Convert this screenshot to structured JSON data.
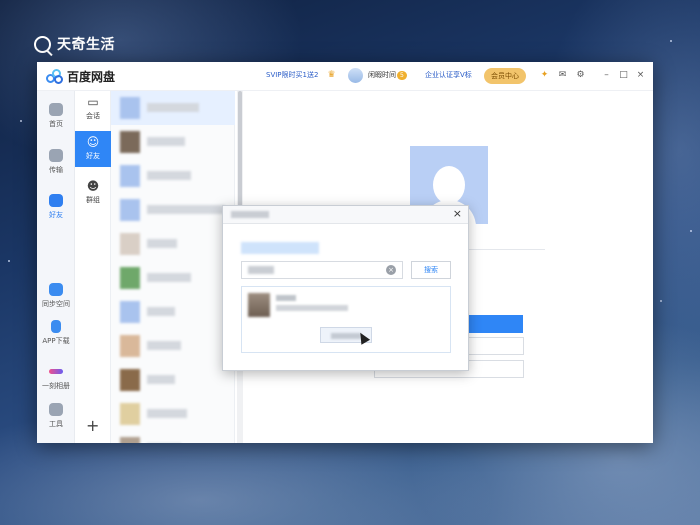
{
  "watermark": {
    "text": "天奇生活"
  },
  "app": {
    "name": "百度网盘",
    "promo": "SVIP限时买1送2",
    "username": "闲暇时间",
    "level_badge": "5",
    "verify": "企业认证享V标",
    "vip_center": "会员中心"
  },
  "nav": {
    "items": [
      {
        "label": "首页",
        "icon": "home-icon"
      },
      {
        "label": "传输",
        "icon": "transfer-icon"
      },
      {
        "label": "好友",
        "icon": "friends-icon"
      },
      {
        "label": "同步空间",
        "icon": "sync-icon"
      },
      {
        "label": "APP下载",
        "icon": "phone-icon"
      },
      {
        "label": "一刻相册",
        "icon": "album-icon"
      },
      {
        "label": "工具",
        "icon": "tools-icon"
      }
    ],
    "active": "好友"
  },
  "subnav": {
    "items": [
      {
        "label": "会话",
        "icon": "chat-icon"
      },
      {
        "label": "好友",
        "icon": "person-icon"
      },
      {
        "label": "群组",
        "icon": "group-icon"
      }
    ],
    "active": "好友",
    "add": "+"
  },
  "dialog": {
    "close": "×",
    "search_button": "搜索"
  },
  "colors": {
    "accent": "#2f86f6",
    "vip": "#f2c46b"
  }
}
